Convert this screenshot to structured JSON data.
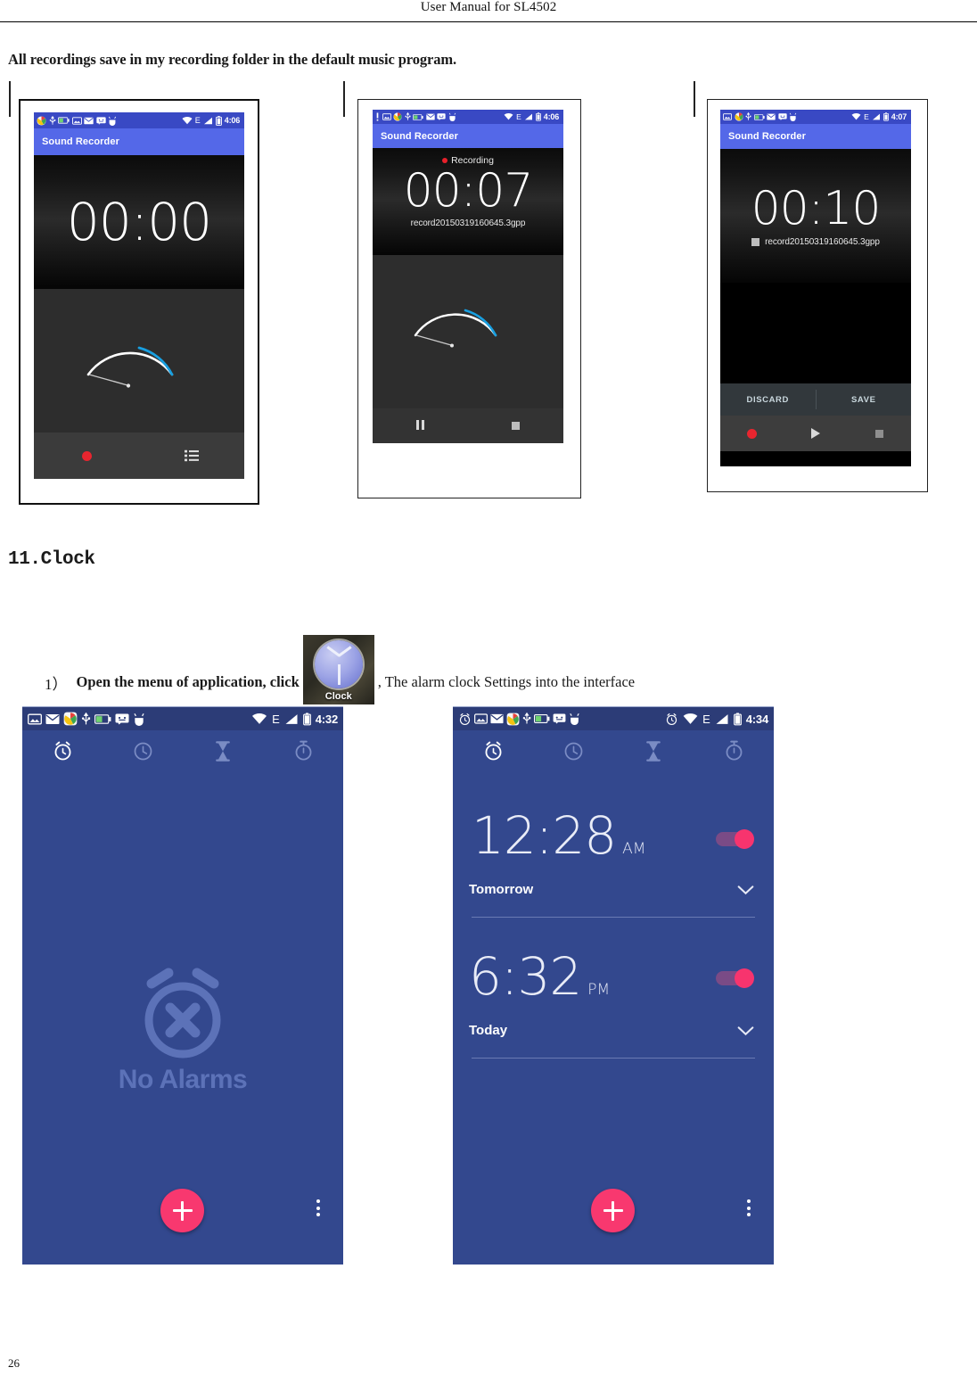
{
  "document": {
    "header_title": "User Manual for SL4502",
    "page_number": "26",
    "intro_text": "All recordings save in my recording folder in the default music program.",
    "section_heading": "11.Clock"
  },
  "step": {
    "number": "1）",
    "text_before": "Open the menu of application, click",
    "icon_label": "Clock",
    "text_after": ", The alarm clock Settings into the interface"
  },
  "recorder_idle": {
    "status_time": "4:06",
    "app_title": "Sound Recorder",
    "timer": "00:00",
    "record_button": "record-dot",
    "list_button": "recordings-list"
  },
  "recorder_recording": {
    "status_time": "4:06",
    "app_title": "Sound Recorder",
    "state_label": "Recording",
    "timer": "00:07",
    "filename": "record20150319160645.3gpp",
    "pause_button": "pause",
    "stop_button": "stop"
  },
  "recorder_finished": {
    "status_time": "4:07",
    "app_title": "Sound Recorder",
    "timer": "00:10",
    "filename": "record20150319160645.3gpp",
    "discard_label": "DISCARD",
    "save_label": "SAVE",
    "record_button": "record-dot",
    "play_button": "play",
    "stop_button": "stop"
  },
  "clock_empty": {
    "status_time": "4:32",
    "tabs": [
      "alarm",
      "clock",
      "hourglass",
      "stopwatch"
    ],
    "active_tab": "alarm",
    "empty_message": "No Alarms",
    "add_button": "add-alarm",
    "overflow_button": "more-options"
  },
  "clock_alarms": {
    "status_time": "4:34",
    "tabs": [
      "alarm",
      "clock",
      "hourglass",
      "stopwatch"
    ],
    "active_tab": "alarm",
    "alarms": [
      {
        "time": "12:28",
        "meridiem": "AM",
        "day": "Tomorrow",
        "enabled": "on"
      },
      {
        "time": "6:32",
        "meridiem": "PM",
        "day": "Today",
        "enabled": "on"
      }
    ],
    "add_button": "add-alarm",
    "overflow_button": "more-options"
  },
  "colors": {
    "status_blue": "#3949c4",
    "appbar_blue": "#5468e8",
    "clock_bg": "#33488e",
    "clock_statusbar": "#2c3c77",
    "accent_pink": "#f8386f",
    "record_red": "#e8252f",
    "meter_blue": "#1e9bdd"
  }
}
